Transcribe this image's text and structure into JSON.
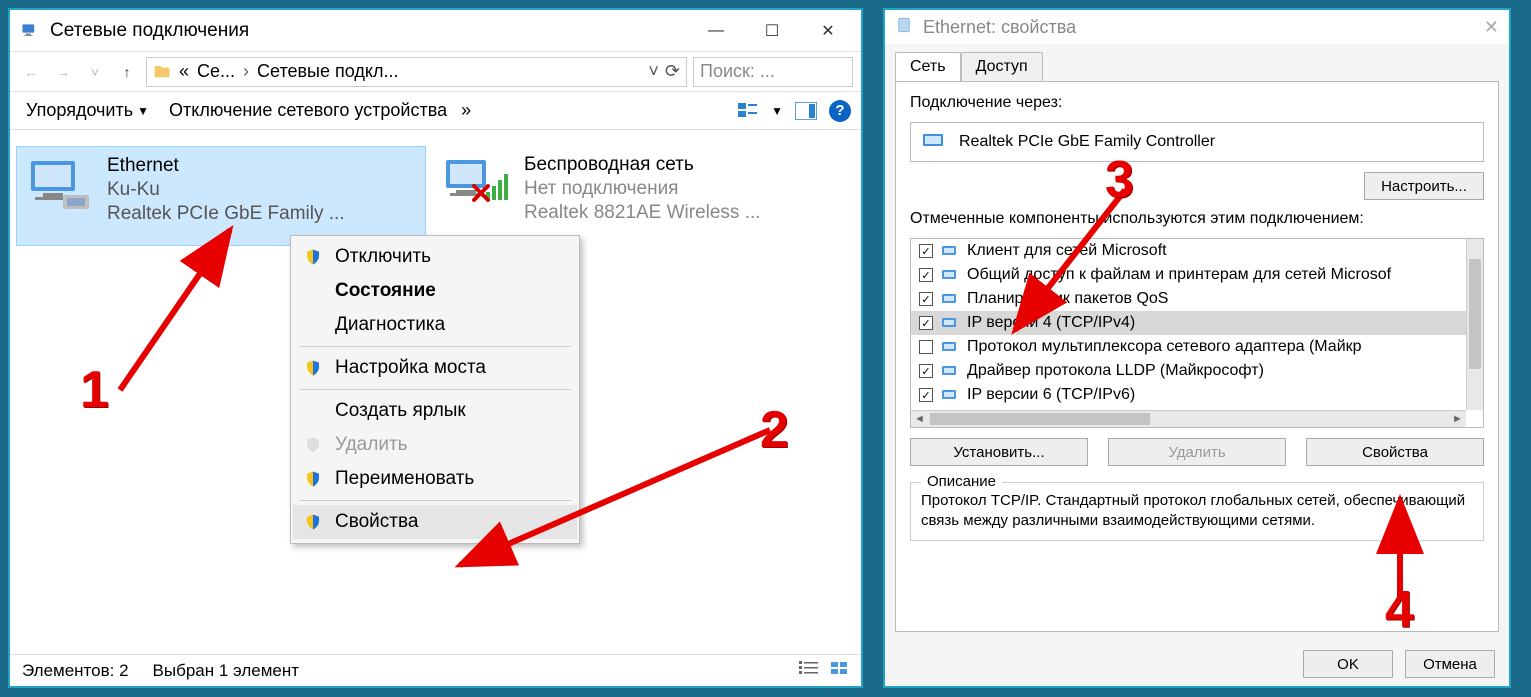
{
  "win1": {
    "title": "Сетевые подключения",
    "address": {
      "seg1": "Се...",
      "seg2": "Сетевые подкл..."
    },
    "search_placeholder": "Поиск: ...",
    "toolbar": {
      "organize": "Упорядочить",
      "disable": "Отключение сетевого устройства"
    },
    "adapters": [
      {
        "name": "Ethernet",
        "line2": "Ku-Ku",
        "line3": "Realtek PCIe GbE Family ..."
      },
      {
        "name": "Беспроводная сеть",
        "line2": "Нет подключения",
        "line3": "Realtek 8821AE Wireless ..."
      }
    ],
    "context_menu": {
      "disable": "Отключить",
      "status": "Состояние",
      "diagnose": "Диагностика",
      "bridge": "Настройка моста",
      "shortcut": "Создать ярлык",
      "delete": "Удалить",
      "rename": "Переименовать",
      "properties": "Свойства"
    },
    "statusbar": {
      "count": "Элементов: 2",
      "selected": "Выбран 1 элемент"
    }
  },
  "win2": {
    "title": "Ethernet: свойства",
    "tabs": {
      "network": "Сеть",
      "sharing": "Доступ"
    },
    "connect_via_label": "Подключение через:",
    "adapter_name": "Realtek PCIe GbE Family Controller",
    "configure_btn": "Настроить...",
    "components_label": "Отмеченные компоненты используются этим подключением:",
    "components": [
      {
        "checked": true,
        "label": "Клиент для сетей Microsoft"
      },
      {
        "checked": true,
        "label": "Общий доступ к файлам и принтерам для сетей Microsof"
      },
      {
        "checked": true,
        "label": "Планировщик пакетов QoS"
      },
      {
        "checked": true,
        "label": "IP версии 4 (TCP/IPv4)",
        "highlighted": true
      },
      {
        "checked": false,
        "label": "Протокол мультиплексора сетевого адаптера (Майкр"
      },
      {
        "checked": true,
        "label": "Драйвер протокола LLDP (Майкрософт)"
      },
      {
        "checked": true,
        "label": "IP версии 6 (TCP/IPv6)"
      }
    ],
    "install_btn": "Установить...",
    "remove_btn": "Удалить",
    "properties_btn": "Свойства",
    "description_title": "Описание",
    "description_text": "Протокол TCP/IP. Стандартный протокол глобальных сетей, обеспечивающий связь между различными взаимодействующими сетями.",
    "ok_btn": "OK",
    "cancel_btn": "Отмена"
  },
  "annotations": {
    "n1": "1",
    "n2": "2",
    "n3": "3",
    "n4": "4"
  }
}
